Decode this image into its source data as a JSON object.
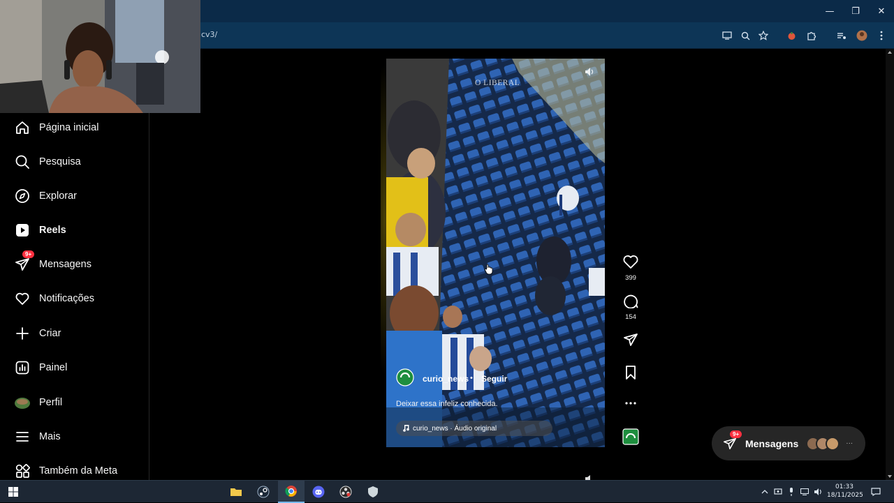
{
  "browser": {
    "url": "cv3/",
    "window_controls": {
      "minimize": "—",
      "restore": "❐",
      "close": "✕"
    },
    "toolbar_icons": [
      "install-app-icon",
      "zoom-icon",
      "bookmark-star-icon",
      "extension-tomato-icon",
      "extensions-puzzle-icon",
      "media-control-icon",
      "profile-avatar-icon",
      "menu-dots-icon"
    ]
  },
  "sidebar": {
    "items": [
      {
        "label": "Página inicial",
        "icon": "home-icon"
      },
      {
        "label": "Pesquisa",
        "icon": "search-icon"
      },
      {
        "label": "Explorar",
        "icon": "compass-icon"
      },
      {
        "label": "Reels",
        "icon": "reels-icon"
      },
      {
        "label": "Mensagens",
        "icon": "messenger-icon",
        "badge": "9+"
      },
      {
        "label": "Notificações",
        "icon": "heart-icon"
      },
      {
        "label": "Criar",
        "icon": "plus-icon"
      },
      {
        "label": "Painel",
        "icon": "dashboard-icon"
      },
      {
        "label": "Perfil",
        "icon": "profile-avatar-icon"
      },
      {
        "label": "Mais",
        "icon": "menu-icon"
      },
      {
        "label": "Também da Meta",
        "icon": "meta-apps-icon"
      }
    ]
  },
  "reel": {
    "watermark": "O LIBERAL",
    "username": "curio_news",
    "separator": "•",
    "follow_label": "Seguir",
    "caption": "Deixar essa infeliz conhecida.",
    "audio": "curio_news · Áudio original",
    "likes": "399",
    "comments": "154"
  },
  "messages_pill": {
    "label": "Mensagens",
    "badge": "9+",
    "more": "···"
  },
  "taskbar": {
    "clock_time": "01:33",
    "clock_date": "18/11/2025"
  },
  "colors": {
    "accent_badge": "#ff3040",
    "titlebar": "#0b2a48",
    "addressbar": "#0d3556",
    "seat_blue": "#2a5aa8"
  }
}
